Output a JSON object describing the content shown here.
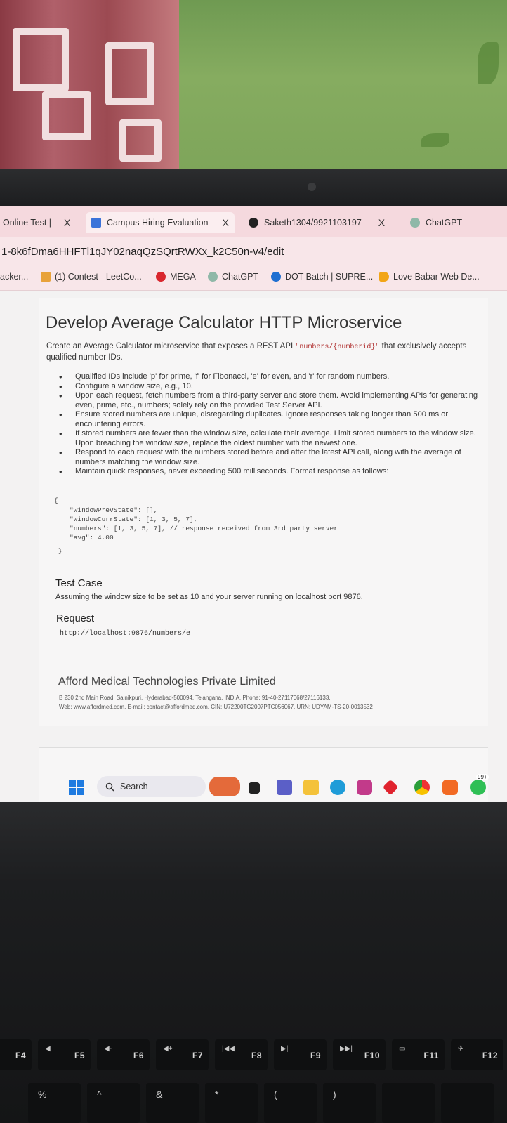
{
  "browser": {
    "tabs": [
      {
        "label": "Online Test | ",
        "close": "X"
      },
      {
        "label": "Campus Hiring Evaluation",
        "close": "X"
      },
      {
        "label": "Saketh1304/9921103197",
        "close": "X"
      },
      {
        "label": "ChatGPT",
        "close": ""
      }
    ],
    "url": "1-8k6fDma6HHFTl1qJY02naqQzSQrtRWXx_k2C50n-v4/edit",
    "bookmarks": [
      {
        "label": "acker..."
      },
      {
        "label": "(1) Contest - LeetCo..."
      },
      {
        "label": "MEGA"
      },
      {
        "label": "ChatGPT"
      },
      {
        "label": "DOT Batch | SUPRE..."
      },
      {
        "label": "Love Babar Web De..."
      }
    ]
  },
  "document": {
    "title": "Develop Average Calculator HTTP Microservice",
    "intro_pre": "Create an Average Calculator microservice that exposes a REST API ",
    "intro_code": "\"numbers/{numberid}\"",
    "intro_post": " that exclusively accepts qualified number IDs.",
    "bullets": [
      "Qualified IDs include 'p' for prime, 'f' for Fibonacci, 'e' for even, and 'r' for random numbers.",
      "Configure a window size, e.g., 10.",
      "Upon each request, fetch numbers from a third-party server and store them. Avoid implementing APIs for generating even, prime, etc., numbers; solely rely on the provided Test Server API.",
      "Ensure stored numbers are unique, disregarding duplicates. Ignore responses taking longer than 500 ms or encountering errors.",
      "If stored numbers are fewer than the window size, calculate their average. Limit stored numbers to the window size. Upon breaching the window size, replace the oldest number with the newest one.",
      "Respond to each request with the numbers stored before and after the latest API call, along with the average of numbers matching the window size.",
      "Maintain quick responses, never exceeding 500 milliseconds. Format response as follows:"
    ],
    "code": {
      "open": "{",
      "line1": "\"windowPrevState\": [],",
      "line2": "\"windowCurrState\": [1, 3, 5, 7],",
      "line3": "\"numbers\": [1, 3, 5, 7], // response received from 3rd party server",
      "line4": "\"avg\": 4.00",
      "close": "}"
    },
    "test_case_title": "Test Case",
    "test_case_desc": "Assuming the window size to be set as 10 and your server running on localhost port 9876.",
    "request_title": "Request",
    "request_url": "http://localhost:9876/numbers/e",
    "company_name": "Afford Medical Technologies Private Limited",
    "address_line1": "B 230 2nd Main Road, Sainikpuri, Hyderabad-500094, Telangana, INDIA. Phone: 91-40-27117068/27116133,",
    "address_line2": "Web: www.affordmed.com, E-mail: contact@affordmed.com, CIN: U72200TG2007PTC056067, URN: UDYAM-TS-20-0013532"
  },
  "taskbar": {
    "search_label": "Search",
    "badge": "99+"
  },
  "keyboard": {
    "fkeys": [
      "F4",
      "F5",
      "F6",
      "F7",
      "F8",
      "F9",
      "F10",
      "F11",
      "F12"
    ],
    "numkeys": [
      "%",
      "^",
      "&",
      "*",
      "(",
      ")"
    ]
  }
}
